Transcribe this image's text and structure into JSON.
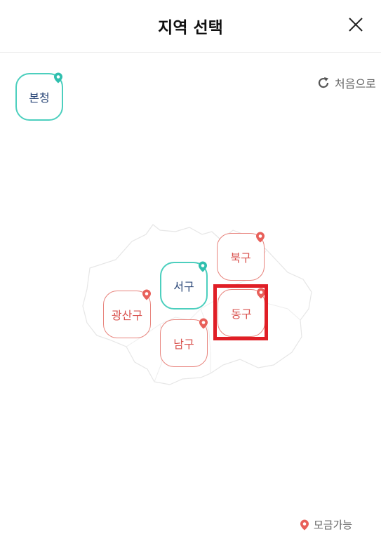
{
  "header": {
    "title": "지역 선택"
  },
  "reset": {
    "label": "처음으로"
  },
  "regions": {
    "hq": {
      "label": "본청",
      "status": "selectable"
    },
    "seo": {
      "label": "서구",
      "status": "selectable"
    },
    "buk": {
      "label": "북구",
      "status": "fundraising"
    },
    "gwangsan": {
      "label": "광산구",
      "status": "fundraising"
    },
    "dong": {
      "label": "동구",
      "status": "fundraising"
    },
    "nam": {
      "label": "남구",
      "status": "fundraising"
    }
  },
  "legend": {
    "label": "모금가능"
  },
  "colors": {
    "teal": "#4ccfbe",
    "red": "#e8605a",
    "highlight": "#e01e26"
  }
}
